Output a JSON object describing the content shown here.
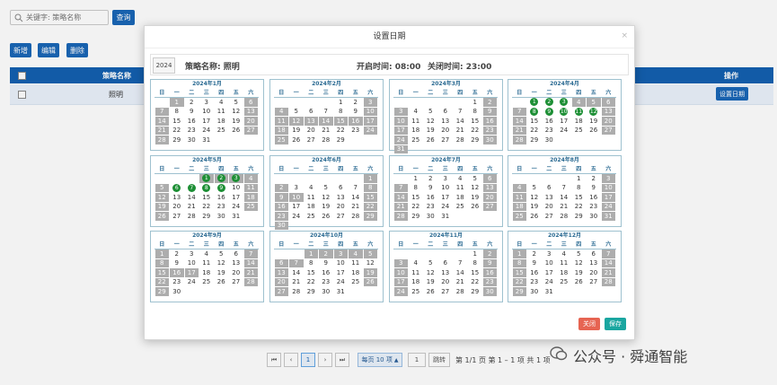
{
  "toolbar": {
    "search_placeholder": "关键字: 策略名称",
    "search_label": "查询",
    "add_label": "新增",
    "edit_label": "编辑",
    "delete_label": "删除"
  },
  "table": {
    "headers": {
      "name": "策略名称",
      "ops": "操作"
    },
    "rows": [
      {
        "name": "照明",
        "action": "设置日期"
      }
    ]
  },
  "pager": {
    "first": "⏮",
    "prev": "‹",
    "page": "1",
    "next": "›",
    "last": "⏭",
    "per_page": "每页 10 项",
    "jump_value": "1",
    "jump_label": "跳转",
    "summary": "第 1/1 页  第 1 – 1 项  共 1 项"
  },
  "watermark": "公众号 · 舜通智能",
  "modal": {
    "title": "设置日期",
    "close": "×",
    "year": "2024",
    "name_label": "策略名称: 照明",
    "open_label": "开启时间: 08:00",
    "close_label": "关闭时间: 23:00",
    "btn_close": "关闭",
    "btn_save": "保存",
    "weekdays": [
      "日",
      "一",
      "二",
      "三",
      "四",
      "五",
      "六"
    ],
    "months": [
      {
        "title": "2024年1月",
        "start": 1,
        "days": 31,
        "gray": [
          1,
          6,
          7,
          13,
          14,
          20,
          21,
          27,
          28
        ],
        "green": []
      },
      {
        "title": "2024年2月",
        "start": 4,
        "days": 29,
        "gray": [
          3,
          4,
          10,
          11,
          12,
          13,
          14,
          15,
          16,
          17,
          18,
          24,
          25
        ],
        "green": []
      },
      {
        "title": "2024年3月",
        "start": 5,
        "days": 31,
        "gray": [
          2,
          3,
          9,
          10,
          16,
          17,
          23,
          24,
          30,
          31
        ],
        "green": []
      },
      {
        "title": "2024年4月",
        "start": 1,
        "days": 30,
        "gray": [
          4,
          5,
          6,
          7,
          13,
          14,
          20,
          21,
          27,
          28
        ],
        "green": [
          1,
          2,
          3,
          8,
          9,
          10,
          11,
          12
        ]
      },
      {
        "title": "2024年5月",
        "start": 3,
        "days": 31,
        "gray": [
          1,
          2,
          3,
          4,
          5,
          11,
          12,
          18,
          19,
          25,
          26
        ],
        "green": [
          1,
          2,
          3,
          6,
          7,
          8,
          9
        ]
      },
      {
        "title": "2024年6月",
        "start": 6,
        "days": 30,
        "gray": [
          1,
          2,
          8,
          9,
          10,
          15,
          16,
          22,
          23,
          29,
          30
        ],
        "green": []
      },
      {
        "title": "2024年7月",
        "start": 1,
        "days": 31,
        "gray": [
          6,
          7,
          13,
          14,
          20,
          21,
          27,
          28
        ],
        "green": []
      },
      {
        "title": "2024年8月",
        "start": 4,
        "days": 31,
        "gray": [
          3,
          4,
          10,
          11,
          17,
          18,
          24,
          25,
          31
        ],
        "green": []
      },
      {
        "title": "2024年9月",
        "start": 0,
        "days": 30,
        "gray": [
          1,
          7,
          8,
          14,
          15,
          16,
          17,
          21,
          22,
          28,
          29
        ],
        "green": []
      },
      {
        "title": "2024年10月",
        "start": 2,
        "days": 31,
        "gray": [
          1,
          2,
          3,
          4,
          5,
          6,
          7,
          13,
          19,
          20,
          26,
          27
        ],
        "green": []
      },
      {
        "title": "2024年11月",
        "start": 5,
        "days": 30,
        "gray": [
          2,
          3,
          9,
          10,
          16,
          17,
          23,
          24,
          30
        ],
        "green": []
      },
      {
        "title": "2024年12月",
        "start": 0,
        "days": 31,
        "gray": [
          1,
          7,
          8,
          14,
          15,
          21,
          22,
          28,
          29
        ],
        "green": []
      }
    ]
  },
  "colors": {
    "primary": "#1a67b7",
    "gray": "#adadad",
    "green": "#1d8f35",
    "close": "#e66452",
    "save": "#1aa6a0"
  }
}
